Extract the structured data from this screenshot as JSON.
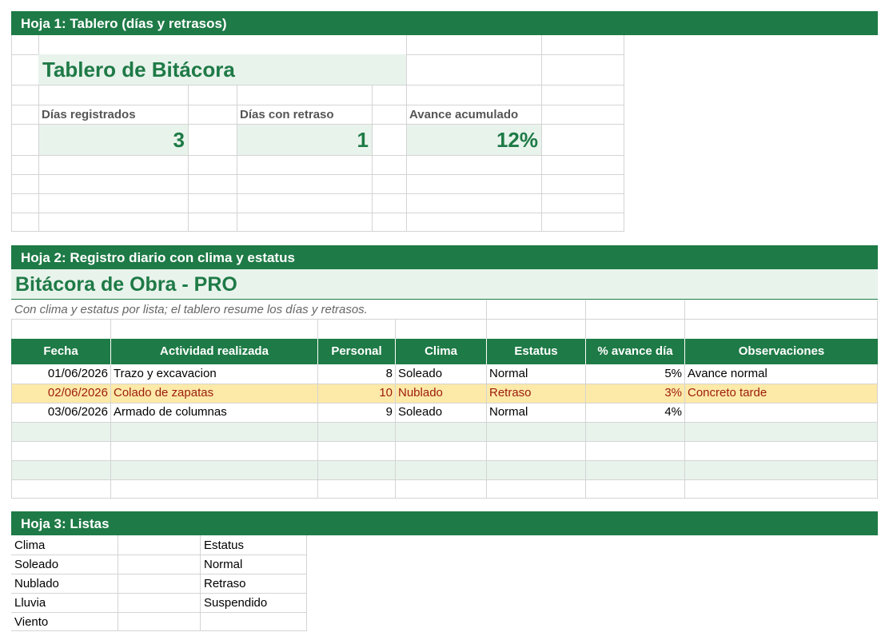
{
  "sheet1": {
    "band_title": "Hoja 1: Tablero (días y retrasos)",
    "title": "Tablero de Bitácora",
    "metrics": [
      {
        "label": "Días registrados",
        "value": "3"
      },
      {
        "label": "Días con retraso",
        "value": "1"
      },
      {
        "label": "Avance acumulado",
        "value": "12%"
      }
    ]
  },
  "sheet2": {
    "band_title": "Hoja 2: Registro diario con clima y estatus",
    "title": "Bitácora de Obra - PRO",
    "subtitle": "Con clima y estatus por lista; el tablero resume los días y retrasos.",
    "columns": [
      "Fecha",
      "Actividad realizada",
      "Personal",
      "Clima",
      "Estatus",
      "% avance día",
      "Observaciones"
    ],
    "rows": [
      {
        "fecha": "01/06/2026",
        "actividad": "Trazo y excavacion",
        "personal": "8",
        "clima": "Soleado",
        "estatus": "Normal",
        "avance": "5%",
        "obs": "Avance normal",
        "highlight": false
      },
      {
        "fecha": "02/06/2026",
        "actividad": "Colado de zapatas",
        "personal": "10",
        "clima": "Nublado",
        "estatus": "Retraso",
        "avance": "3%",
        "obs": "Concreto tarde",
        "highlight": true
      },
      {
        "fecha": "03/06/2026",
        "actividad": "Armado de columnas",
        "personal": "9",
        "clima": "Soleado",
        "estatus": "Normal",
        "avance": "4%",
        "obs": "",
        "highlight": false
      }
    ]
  },
  "sheet3": {
    "band_title": "Hoja 3: Listas",
    "clima_header": "Clima",
    "clima": [
      "Soleado",
      "Nublado",
      "Lluvia",
      "Viento"
    ],
    "estatus_header": "Estatus",
    "estatus": [
      "Normal",
      "Retraso",
      "Suspendido"
    ]
  },
  "colors": {
    "brand_green": "#1e7a46",
    "light_green": "#e8f3ec",
    "delay_fill": "#fde9a8",
    "delay_text": "#9c1c0b"
  }
}
